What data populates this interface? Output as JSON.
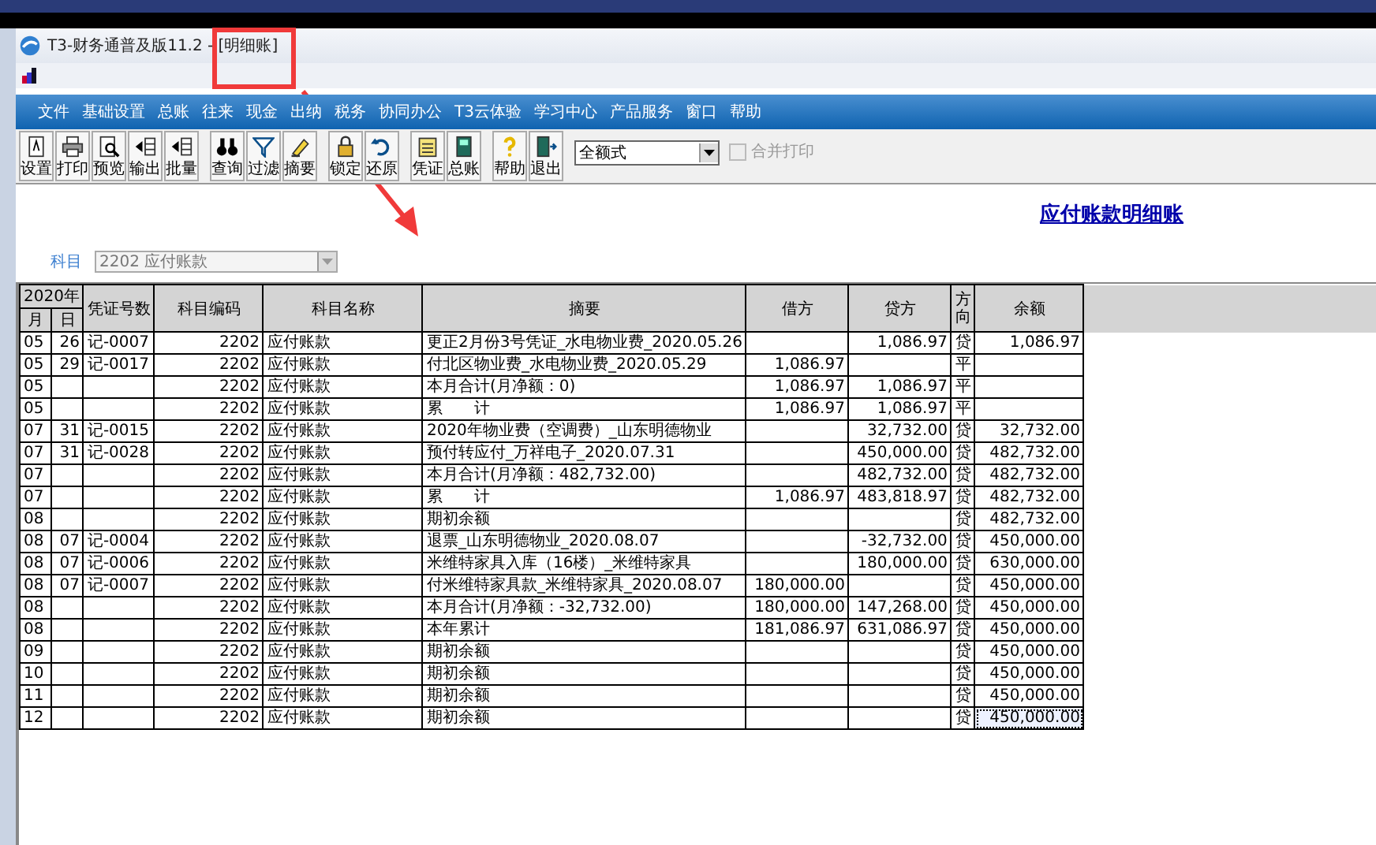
{
  "window": {
    "title": "T3-财务通普及版11.2 - [明细账]"
  },
  "menu": [
    "文件",
    "基础设置",
    "总账",
    "往来",
    "现金",
    "出纳",
    "税务",
    "协同办公",
    "T3云体验",
    "学习中心",
    "产品服务",
    "窗口",
    "帮助"
  ],
  "toolbar": {
    "groups": [
      [
        {
          "label": "设置"
        },
        {
          "label": "打印"
        },
        {
          "label": "预览"
        },
        {
          "label": "输出"
        },
        {
          "label": "批量"
        }
      ],
      [
        {
          "label": "查询"
        },
        {
          "label": "过滤"
        },
        {
          "label": "摘要"
        }
      ],
      [
        {
          "label": "锁定"
        },
        {
          "label": "还原"
        }
      ],
      [
        {
          "label": "凭证"
        },
        {
          "label": "总账"
        }
      ],
      [
        {
          "label": "帮助"
        },
        {
          "label": "退出"
        }
      ]
    ],
    "format_select": {
      "value": "全额式"
    },
    "merge_print": {
      "label": "合并打印",
      "checked": false,
      "disabled": true
    }
  },
  "report": {
    "title": "应付账款明细账",
    "subject": {
      "label": "科目",
      "value": "2202 应付账款"
    }
  },
  "table": {
    "year": "2020年",
    "columns": [
      "月",
      "日",
      "凭证号数",
      "科目编码",
      "科目名称",
      "摘要",
      "借方",
      "贷方",
      "方向",
      "余额"
    ],
    "rows": [
      {
        "cells": [
          "05",
          "26",
          "记-0007",
          "2202",
          "应付账款",
          "更正2月份3号凭证_水电物业费_2020.05.26",
          "",
          "1,086.97",
          "贷",
          "1,086.97"
        ],
        "selected": false
      },
      {
        "cells": [
          "05",
          "29",
          "记-0017",
          "2202",
          "应付账款",
          "付北区物业费_水电物业费_2020.05.29",
          "1,086.97",
          "",
          "平",
          ""
        ],
        "selected": false
      },
      {
        "cells": [
          "05",
          "",
          "",
          "2202",
          "应付账款",
          "本月合计(月净额：0)",
          "1,086.97",
          "1,086.97",
          "平",
          ""
        ],
        "selected": false
      },
      {
        "cells": [
          "05",
          "",
          "",
          "2202",
          "应付账款",
          "累　　计",
          "1,086.97",
          "1,086.97",
          "平",
          ""
        ],
        "selected": false
      },
      {
        "cells": [
          "07",
          "31",
          "记-0015",
          "2202",
          "应付账款",
          "2020年物业费（空调费）_山东明德物业",
          "",
          "32,732.00",
          "贷",
          "32,732.00"
        ],
        "selected": false
      },
      {
        "cells": [
          "07",
          "31",
          "记-0028",
          "2202",
          "应付账款",
          "预付转应付_万祥电子_2020.07.31",
          "",
          "450,000.00",
          "贷",
          "482,732.00"
        ],
        "selected": false
      },
      {
        "cells": [
          "07",
          "",
          "",
          "2202",
          "应付账款",
          "本月合计(月净额：482,732.00)",
          "",
          "482,732.00",
          "贷",
          "482,732.00"
        ],
        "selected": false
      },
      {
        "cells": [
          "07",
          "",
          "",
          "2202",
          "应付账款",
          "累　　计",
          "1,086.97",
          "483,818.97",
          "贷",
          "482,732.00"
        ],
        "selected": false
      },
      {
        "cells": [
          "08",
          "",
          "",
          "2202",
          "应付账款",
          "期初余额",
          "",
          "",
          "贷",
          "482,732.00"
        ],
        "selected": false
      },
      {
        "cells": [
          "08",
          "07",
          "记-0004",
          "2202",
          "应付账款",
          "退票_山东明德物业_2020.08.07",
          "",
          "-32,732.00",
          "贷",
          "450,000.00"
        ],
        "selected": false
      },
      {
        "cells": [
          "08",
          "07",
          "记-0006",
          "2202",
          "应付账款",
          "米维特家具入库（16楼）_米维特家具",
          "",
          "180,000.00",
          "贷",
          "630,000.00"
        ],
        "selected": false
      },
      {
        "cells": [
          "08",
          "07",
          "记-0007",
          "2202",
          "应付账款",
          "付米维特家具款_米维特家具_2020.08.07",
          "180,000.00",
          "",
          "贷",
          "450,000.00"
        ],
        "selected": false
      },
      {
        "cells": [
          "08",
          "",
          "",
          "2202",
          "应付账款",
          "本月合计(月净额：-32,732.00)",
          "180,000.00",
          "147,268.00",
          "贷",
          "450,000.00"
        ],
        "selected": false
      },
      {
        "cells": [
          "08",
          "",
          "",
          "2202",
          "应付账款",
          "本年累计",
          "181,086.97",
          "631,086.97",
          "贷",
          "450,000.00"
        ],
        "selected": false
      },
      {
        "cells": [
          "09",
          "",
          "",
          "2202",
          "应付账款",
          "期初余额",
          "",
          "",
          "贷",
          "450,000.00"
        ],
        "selected": false
      },
      {
        "cells": [
          "10",
          "",
          "",
          "2202",
          "应付账款",
          "期初余额",
          "",
          "",
          "贷",
          "450,000.00"
        ],
        "selected": false
      },
      {
        "cells": [
          "11",
          "",
          "",
          "2202",
          "应付账款",
          "期初余额",
          "",
          "",
          "贷",
          "450,000.00"
        ],
        "selected": false
      },
      {
        "cells": [
          "12",
          "",
          "",
          "2202",
          "应付账款",
          "期初余额",
          "",
          "",
          "贷",
          "450,000.00"
        ],
        "selected": true
      }
    ]
  }
}
